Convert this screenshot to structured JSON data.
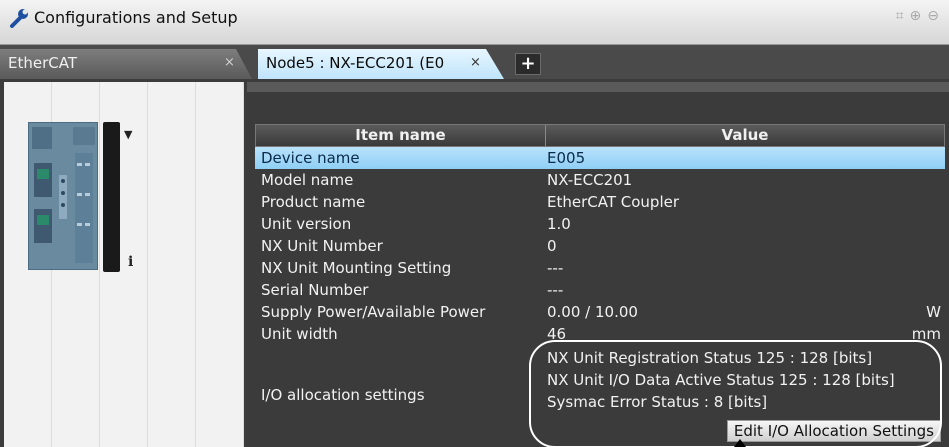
{
  "window": {
    "title": "Configurations and Setup",
    "title_icons": [
      "fit-icon",
      "zoom-in-icon",
      "zoom-out-icon"
    ]
  },
  "tabs": [
    {
      "label": "EtherCAT",
      "close": "×",
      "active": false
    },
    {
      "label": "Node5 : NX-ECC201 (E0",
      "close": "×",
      "active": true
    }
  ],
  "add_tab": "+",
  "device_panel": {
    "info_glyph": "i",
    "dropdown_glyph": "▼"
  },
  "table": {
    "headers": {
      "name": "Item name",
      "value": "Value"
    },
    "rows": [
      {
        "name": "Device name",
        "value": "E005",
        "unit": ""
      },
      {
        "name": "Model name",
        "value": "NX-ECC201",
        "unit": ""
      },
      {
        "name": "Product name",
        "value": "EtherCAT Coupler",
        "unit": ""
      },
      {
        "name": "Unit version",
        "value": "1.0",
        "unit": ""
      },
      {
        "name": "NX Unit Number",
        "value": "0",
        "unit": ""
      },
      {
        "name": "NX Unit Mounting Setting",
        "value": "---",
        "unit": ""
      },
      {
        "name": "Serial Number",
        "value": "---",
        "unit": ""
      },
      {
        "name": "Supply Power/Available Power",
        "value": "0.00 / 10.00",
        "unit": "W"
      },
      {
        "name": "Unit width",
        "value": "46",
        "unit": "mm"
      }
    ],
    "io": {
      "name": "I/O allocation settings",
      "lines": [
        "NX Unit Registration Status 125 : 128 [bits]",
        "NX Unit I/O Data Active Status 125 : 128 [bits]",
        "Sysmac Error Status : 8 [bits]"
      ],
      "button": "Edit I/O Allocation Settings"
    }
  },
  "colors": {
    "selected_row": "#a8dbf9",
    "panel_dark": "#3b3b3b",
    "tab_active": "#cfeafc"
  }
}
